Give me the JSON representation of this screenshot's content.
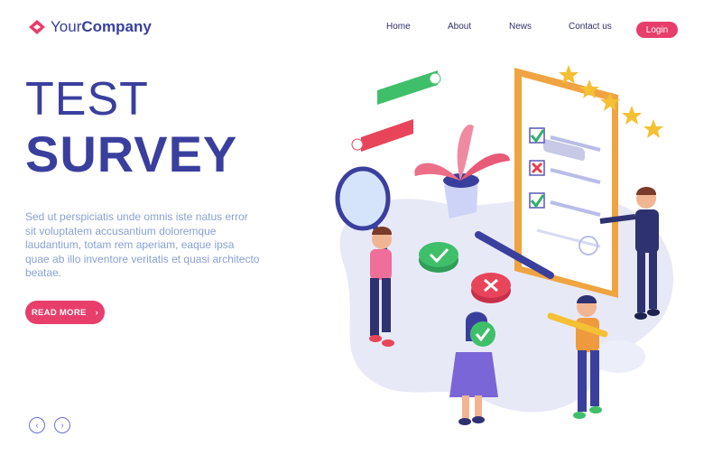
{
  "brand": {
    "name_light": "Your",
    "name_bold": "Company",
    "logo_icon": "diamond-logo-icon"
  },
  "nav": {
    "items": [
      "Home",
      "About",
      "News",
      "Contact us"
    ],
    "login_label": "Login"
  },
  "hero": {
    "title_line1": "TEST",
    "title_line2": "SURVEY",
    "body": "Sed ut perspiciatis unde omnis iste natus error sit voluptatem accusantium doloremque laudantium, totam rem aperiam, eaque ipsa quae ab illo inventore veritatis et quasi architecto beatae.",
    "cta_label": "READ MORE",
    "cta_icon": "chevron-right-icon"
  },
  "pager": {
    "prev_icon": "chevron-left-icon",
    "next_icon": "chevron-right-icon"
  },
  "illustration": {
    "rating_stars": 5,
    "checklist": [
      "check",
      "cross",
      "check"
    ]
  },
  "colors": {
    "primary": "#3a3f9e",
    "accent": "#e83e6c",
    "muted_text": "#8aa0d6",
    "blob": "#e8e9f7"
  }
}
